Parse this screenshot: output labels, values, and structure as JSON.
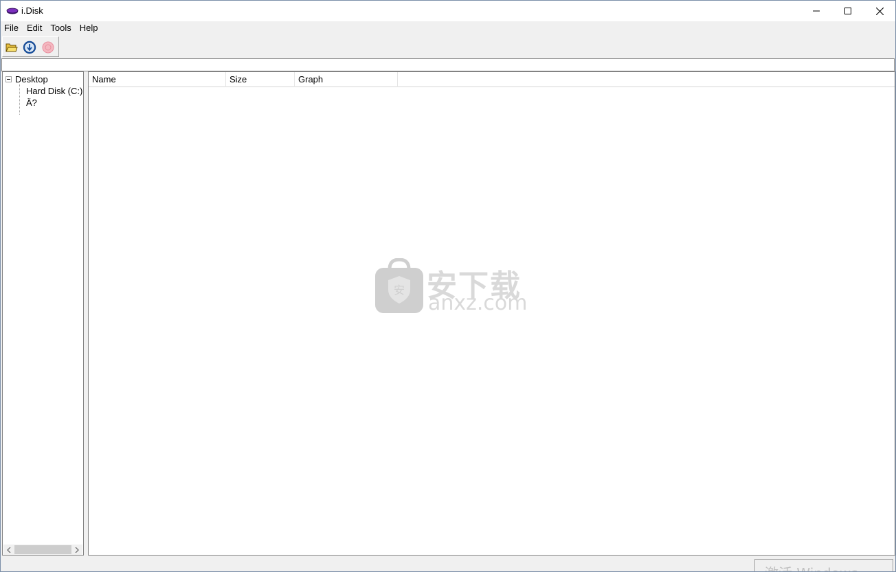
{
  "window": {
    "title": "i.Disk",
    "icon": "disk-icon"
  },
  "menu": {
    "items": [
      "File",
      "Edit",
      "Tools",
      "Help"
    ]
  },
  "toolbar": {
    "buttons": [
      "open-folder-icon",
      "refresh-icon",
      "stop-icon"
    ]
  },
  "address": {
    "value": ""
  },
  "tree": {
    "root": "Desktop",
    "children": [
      "Hard Disk (C:)",
      "Ä?"
    ]
  },
  "list": {
    "columns": [
      "Name",
      "Size",
      "Graph"
    ],
    "rows": []
  },
  "watermark": {
    "cn": "安下载",
    "en": "anxz.com"
  },
  "status": {
    "text": "激活 Windows"
  },
  "colors": {
    "accent_icon": "#7b2fbe",
    "border": "#828282",
    "chrome": "#f0f0f0"
  }
}
